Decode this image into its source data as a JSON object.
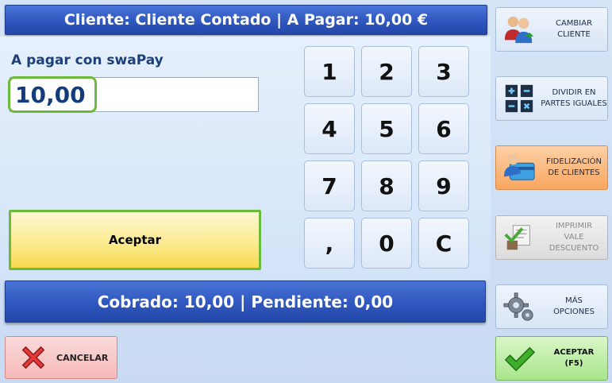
{
  "header": {
    "title": "Cliente: Cliente Contado  | A Pagar: 10,00 €"
  },
  "payment": {
    "label": "A pagar con swaPay",
    "amount": "10,00",
    "accept_label": "Aceptar"
  },
  "keypad": {
    "keys": [
      "1",
      "2",
      "3",
      "4",
      "5",
      "6",
      "7",
      "8",
      "9",
      ",",
      "0",
      "C"
    ]
  },
  "status": {
    "text": "Cobrado: 10,00 | Pendiente: 0,00"
  },
  "cancel": {
    "label": "CANCELAR"
  },
  "side": {
    "change_client": "CAMBIAR\nCLIENTE",
    "split": "DIVIDIR EN\nPARTES IGUALES",
    "loyalty": "FIDELIZACIÓN\nDE CLIENTES",
    "print_voucher": "IMPRIMIR\nVALE\nDESCUENTO",
    "more_options": "MÁS\nOPCIONES",
    "accept": "ACEPTAR\n(F5)"
  },
  "colors": {
    "header_blue": "#2f57bf",
    "highlight_green": "#6cba3c",
    "accept_yellow": "#fbe98a",
    "loyalty_orange": "#f9a660",
    "cancel_red": "#f5b9b9",
    "accept_green": "#a9e58c"
  }
}
